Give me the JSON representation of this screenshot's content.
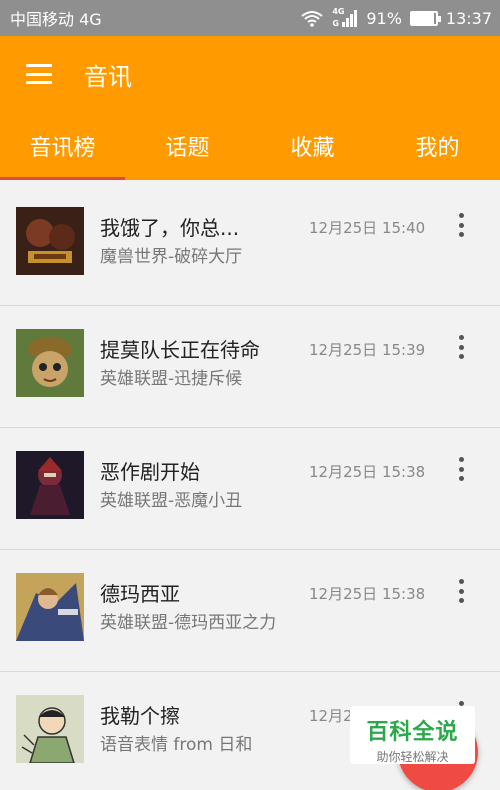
{
  "status": {
    "carrier": "中国移动 4G",
    "net_top": "4G",
    "net_bottom": "G",
    "battery": "91%",
    "battery_level": 0.91,
    "time": "13:37"
  },
  "toolbar": {
    "title": "音讯",
    "menu_icon": "hamburger-menu-icon"
  },
  "tabs": [
    {
      "label": "音讯榜",
      "selected": true
    },
    {
      "label": "话题",
      "selected": false
    },
    {
      "label": "收藏",
      "selected": false
    },
    {
      "label": "我的",
      "selected": false
    }
  ],
  "colors": {
    "primary": "#ff9b00",
    "accent": "#ef4b43",
    "indicator": "#e8473e"
  },
  "items": [
    {
      "title": "我饿了，你总...",
      "subtitle": "魔兽世界-破碎大厅",
      "time": "12月25日 15:40"
    },
    {
      "title": "提莫队长正在待命",
      "subtitle": "英雄联盟-迅捷斥候",
      "time": "12月25日 15:39"
    },
    {
      "title": "恶作剧开始",
      "subtitle": "英雄联盟-恶魔小丑",
      "time": "12月25日 15:38"
    },
    {
      "title": "德玛西亚",
      "subtitle": "英雄联盟-德玛西亚之力",
      "time": "12月25日 15:38"
    },
    {
      "title": "我勒个擦",
      "subtitle": "语音表情 from 日和",
      "time": "12月2"
    }
  ],
  "watermark": {
    "main": "百科全说",
    "sub": "助你轻松解决"
  }
}
